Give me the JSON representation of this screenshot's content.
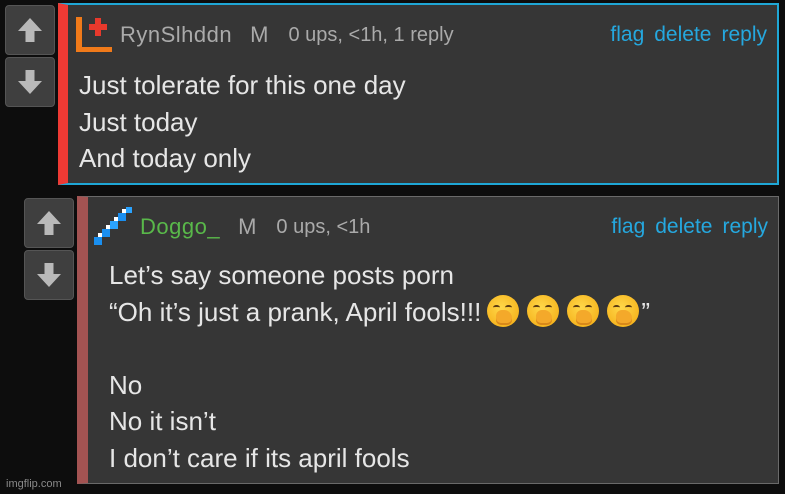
{
  "comments": [
    {
      "username": "RynSlhddn",
      "badge": "M",
      "meta": "0 ups, <1h, 1 reply",
      "actions": {
        "flag": "flag",
        "delete": "delete",
        "reply": "reply"
      },
      "avatar_icon": "orange-plus-avatar-icon",
      "lines": [
        "Just tolerate for this one day",
        "Just today",
        "And today only"
      ]
    },
    {
      "username": "Doggo_",
      "badge": "M",
      "meta": "0 ups, <1h",
      "actions": {
        "flag": "flag",
        "delete": "delete",
        "reply": "reply"
      },
      "avatar_icon": "blue-pixel-diagonal-avatar-icon",
      "lines": [
        "Let’s say someone posts porn",
        "“Oh it’s just a prank, April fools!!!",
        "”",
        "",
        "No",
        "No it isn’t",
        "I don’t care if its april fools"
      ],
      "emoji": "face-with-hand-over-mouth-icon",
      "emoji_count": 4
    }
  ],
  "vote": {
    "up_icon": "upvote-arrow-icon",
    "down_icon": "downvote-arrow-icon"
  },
  "watermark": "imgflip.com",
  "colors": {
    "background": "#0d0d0d",
    "comment_bg": "#363636",
    "selected_border": "#1fa7d6",
    "left_stripe_1": "#ee3a34",
    "left_stripe_2": "#a35352",
    "action_link": "#25a8df",
    "username_2": "#59b84a",
    "text": "#e6e6e6",
    "muted": "#aaaaaa"
  }
}
